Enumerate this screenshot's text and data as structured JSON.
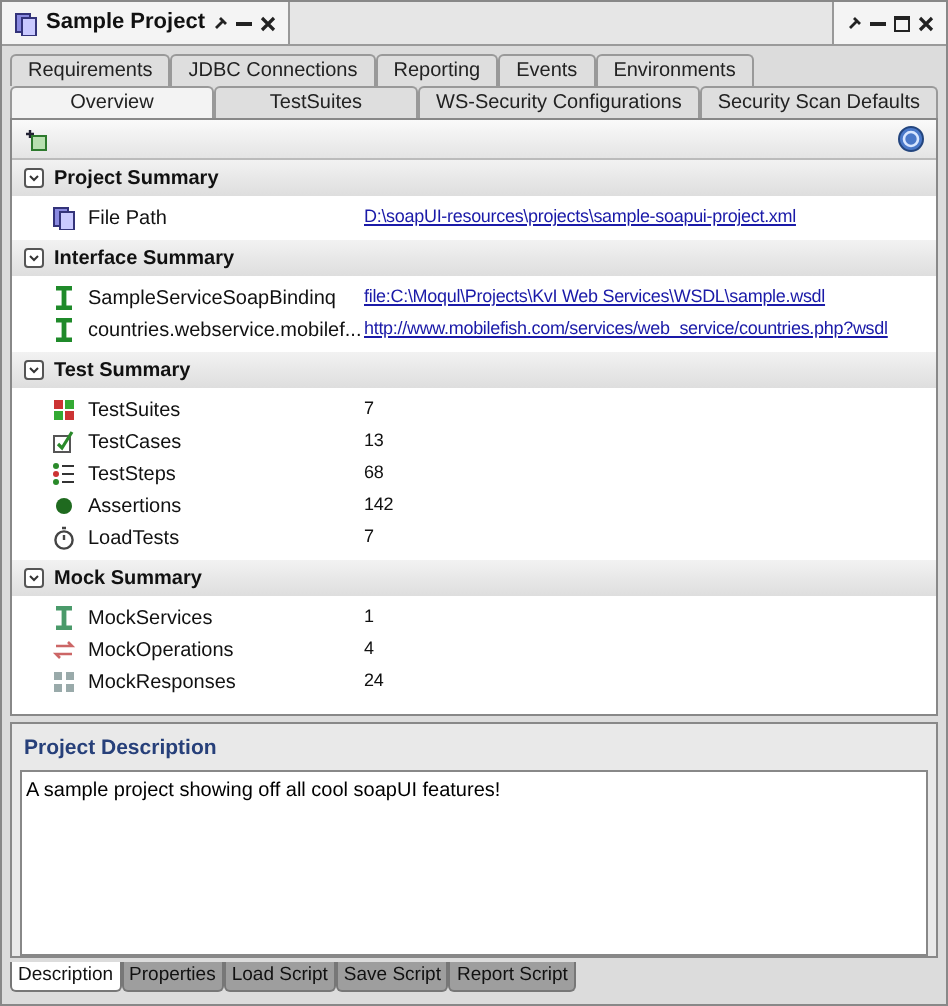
{
  "window": {
    "title": "Sample Project"
  },
  "tab_rows": [
    [
      {
        "label": "Requirements",
        "selected": false
      },
      {
        "label": "JDBC Connections",
        "selected": false
      },
      {
        "label": "Reporting",
        "selected": false
      },
      {
        "label": "Events",
        "selected": false
      },
      {
        "label": "Environments",
        "selected": false
      }
    ],
    [
      {
        "label": "Overview",
        "selected": true
      },
      {
        "label": "TestSuites",
        "selected": false
      },
      {
        "label": "WS-Security Configurations",
        "selected": false
      },
      {
        "label": "Security Scan Defaults",
        "selected": false
      }
    ]
  ],
  "sections": [
    {
      "title": "Project Summary",
      "expanded": true,
      "rows": [
        {
          "label": "File Path",
          "value": "D:\\soapUI-resources\\projects\\sample-soapui-project.xml",
          "kind": "link"
        }
      ]
    },
    {
      "title": "Interface Summary",
      "expanded": true,
      "rows": [
        {
          "label": "SampleServiceSoapBindinq",
          "value": "file:C:\\Moqul\\Projects\\KvI Web Services\\WSDL\\sample.wsdl",
          "kind": "link"
        },
        {
          "label": "countries.webservice.mobilef...",
          "value": "http://www.mobilefish.com/services/web_service/countries.php?wsdl",
          "kind": "link"
        }
      ]
    },
    {
      "title": "Test Summary",
      "expanded": true,
      "rows": [
        {
          "label": "TestSuites",
          "value": "7",
          "kind": "count"
        },
        {
          "label": "TestCases",
          "value": "13",
          "kind": "count"
        },
        {
          "label": "TestSteps",
          "value": "68",
          "kind": "count"
        },
        {
          "label": "Assertions",
          "value": "142",
          "kind": "count"
        },
        {
          "label": "LoadTests",
          "value": "7",
          "kind": "count"
        }
      ]
    },
    {
      "title": "Mock Summary",
      "expanded": true,
      "rows": [
        {
          "label": "MockServices",
          "value": "1",
          "kind": "count"
        },
        {
          "label": "MockOperations",
          "value": "4",
          "kind": "count"
        },
        {
          "label": "MockResponses",
          "value": "24",
          "kind": "count"
        }
      ]
    }
  ],
  "description": {
    "title": "Project Description",
    "value": "A sample project showing off all cool soapUI features!"
  },
  "bottom_tabs": [
    {
      "label": "Description",
      "selected": true
    },
    {
      "label": "Properties",
      "selected": false
    },
    {
      "label": "Load Script",
      "selected": false
    },
    {
      "label": "Save Script",
      "selected": false
    },
    {
      "label": "Report Script",
      "selected": false
    }
  ]
}
